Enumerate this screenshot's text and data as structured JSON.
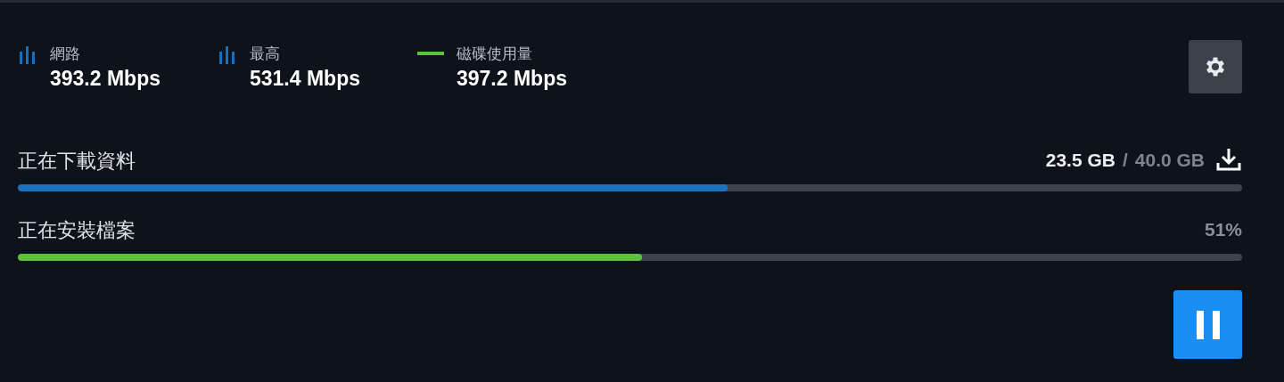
{
  "stats": [
    {
      "kind": "bars",
      "color": "#1a6fb8",
      "label": "網路",
      "value": "393.2 Mbps"
    },
    {
      "kind": "bars",
      "color": "#1a6fb8",
      "label": "最高",
      "value": "531.4 Mbps"
    },
    {
      "kind": "line",
      "color": "#5bc23c",
      "label": "磁碟使用量",
      "value": "397.2 Mbps"
    }
  ],
  "settings_button": {
    "kind": "gear"
  },
  "progress": [
    {
      "label": "正在下載資料",
      "color": "#1a73c0",
      "level": 0.58,
      "done": "23.5 GB",
      "separator": "/",
      "total": "40.0 GB",
      "kind": "download"
    },
    {
      "kind": "install",
      "label": "正在安裝檔案",
      "color": "#5bc23c",
      "level": 0.51,
      "reading": "51%"
    }
  ],
  "action_button": {
    "kind": "pause"
  }
}
